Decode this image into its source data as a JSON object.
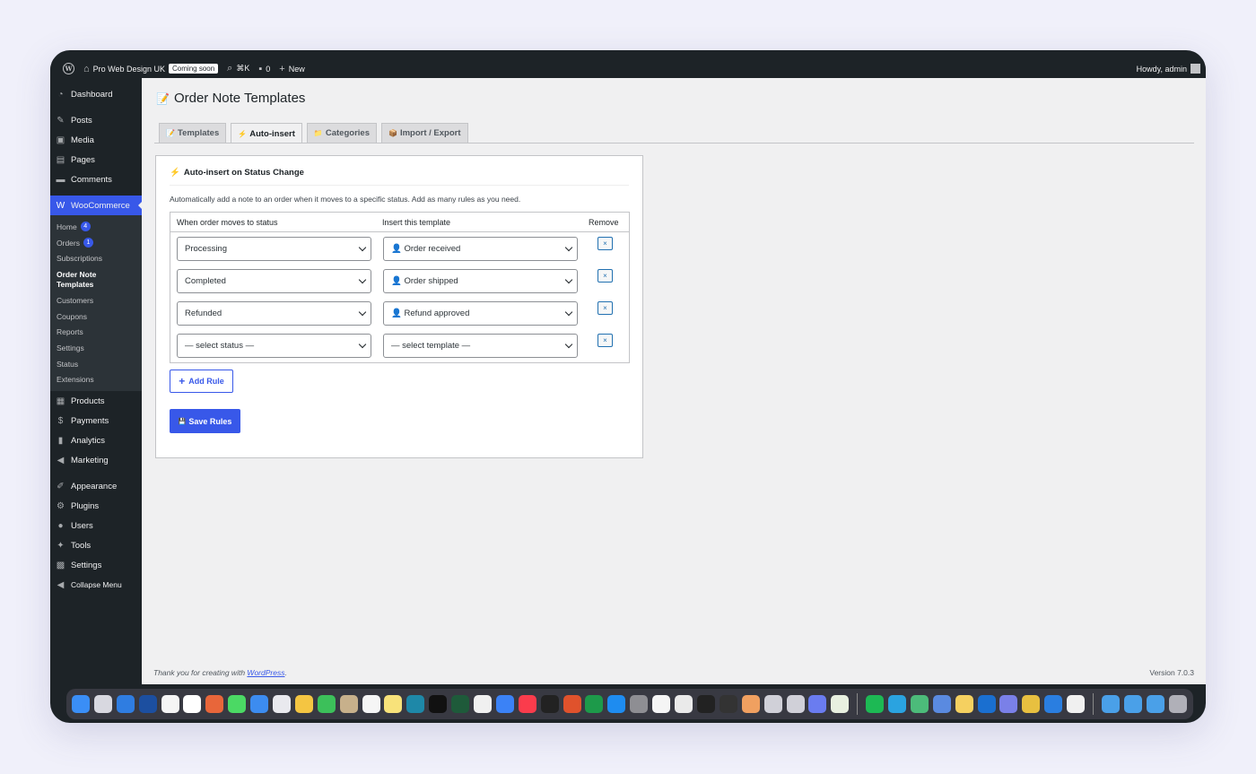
{
  "adminbar": {
    "site_name": "Pro Web Design UK",
    "coming_soon": "Coming soon",
    "search_shortcut": "⌘K",
    "comments_count": "0",
    "new_label": "New",
    "howdy": "Howdy, admin"
  },
  "sidebar": {
    "dashboard": "Dashboard",
    "posts": "Posts",
    "media": "Media",
    "pages": "Pages",
    "comments": "Comments",
    "woocommerce": "WooCommerce",
    "sub": {
      "home": "Home",
      "home_badge": "4",
      "orders": "Orders",
      "orders_badge": "1",
      "subscriptions": "Subscriptions",
      "order_note_templates": "Order Note Templates",
      "customers": "Customers",
      "coupons": "Coupons",
      "reports": "Reports",
      "settings": "Settings",
      "status": "Status",
      "extensions": "Extensions"
    },
    "products": "Products",
    "payments": "Payments",
    "analytics": "Analytics",
    "marketing": "Marketing",
    "appearance": "Appearance",
    "plugins": "Plugins",
    "users": "Users",
    "tools": "Tools",
    "settings": "Settings",
    "collapse": "Collapse Menu"
  },
  "page": {
    "title_icon": "📝",
    "title": "Order Note Templates",
    "tabs": [
      {
        "icon": "📝",
        "label": "Templates"
      },
      {
        "icon": "⚡",
        "label": "Auto-insert"
      },
      {
        "icon": "📁",
        "label": "Categories"
      },
      {
        "icon": "📦",
        "label": "Import / Export"
      }
    ]
  },
  "card": {
    "title_icon": "⚡",
    "title": "Auto-insert on Status Change",
    "description": "Automatically add a note to an order when it moves to a specific status. Add as many rules as you need.",
    "col_status": "When order moves to status",
    "col_template": "Insert this template",
    "col_remove": "Remove",
    "rules": [
      {
        "status": "Processing",
        "template": "👤 Order received"
      },
      {
        "status": "Completed",
        "template": "👤 Order shipped"
      },
      {
        "status": "Refunded",
        "template": "👤 Refund approved"
      },
      {
        "status": "— select status —",
        "template": "— select template —"
      }
    ],
    "remove_symbol": "×",
    "add_rule": "Add Rule",
    "save_rules": "Save Rules",
    "save_icon": "💾"
  },
  "footer": {
    "thanks_prefix": "Thank you for creating with ",
    "wordpress_link": "WordPress",
    "thanks_suffix": ".",
    "version": "Version 7.0.3"
  },
  "colors": {
    "accent": "#3858e9",
    "admin_bg": "#1d2327",
    "content_bg": "#f0f0f1"
  }
}
